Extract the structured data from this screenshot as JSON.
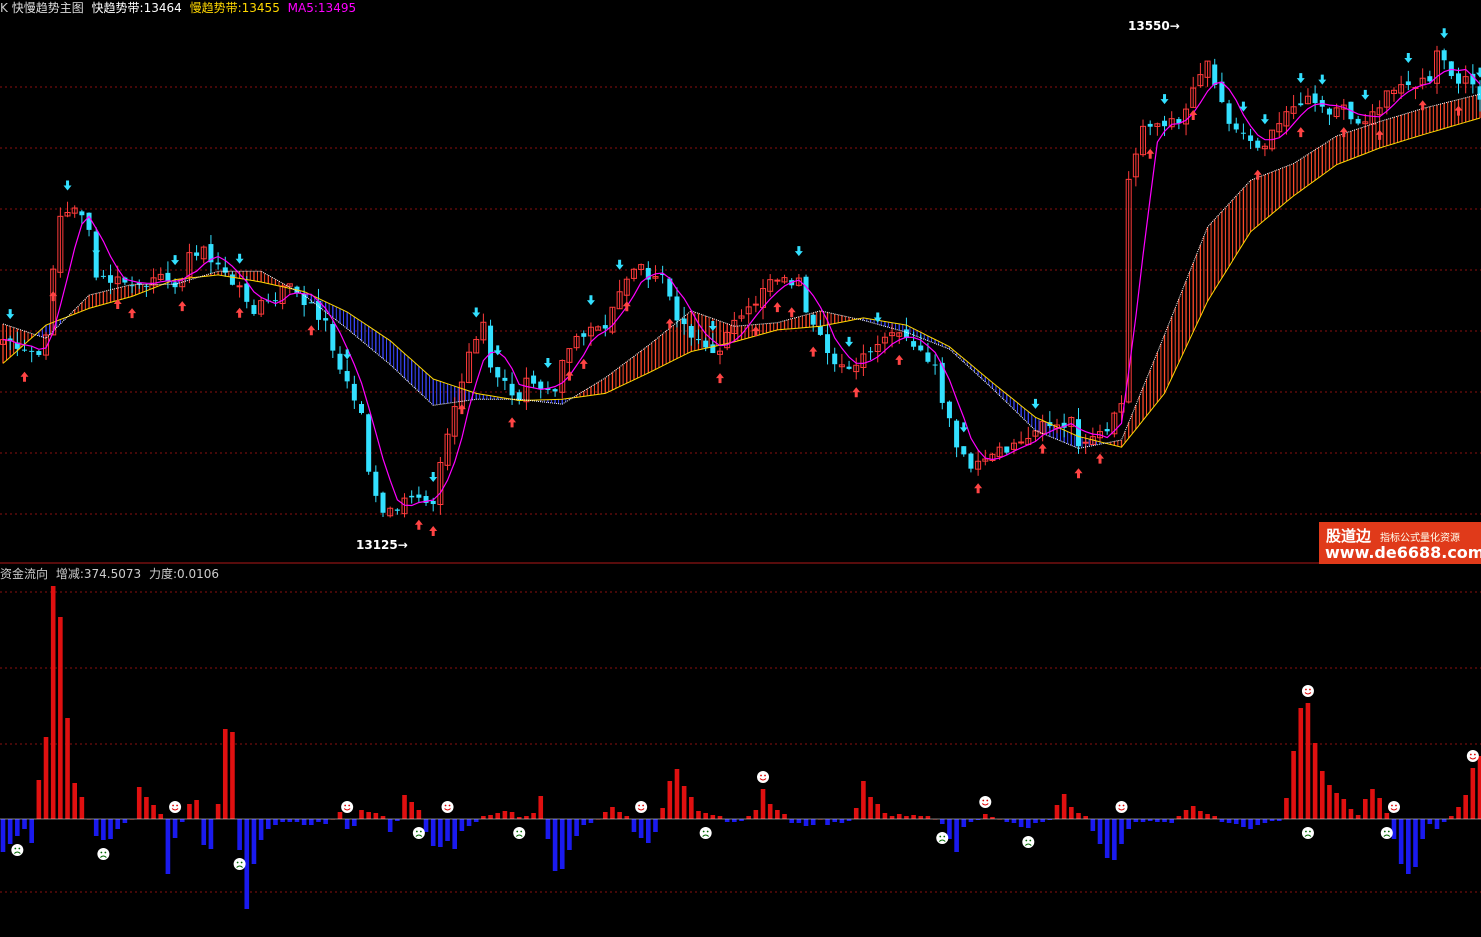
{
  "main_legend": {
    "mark": "K",
    "title": "快慢趋势主图",
    "fast_label": "快趋势带:",
    "fast_value": "13464",
    "slow_label": "慢趋势带:",
    "slow_value": "13455",
    "ma_label": "MA5:",
    "ma_value": "13495"
  },
  "sub_legend": {
    "title": "资金流向",
    "delta_label": "增减:",
    "delta_value": "374.5073",
    "force_label": "力度:",
    "force_value": "0.0106"
  },
  "extremes": {
    "high": "13550",
    "low": "13125"
  },
  "watermark": {
    "title": "股道边",
    "subtitle": "指标公式量化资源",
    "url": "www.de6688.com"
  },
  "colors": {
    "background": "#000000",
    "up": "#ff3b3b",
    "down": "#33e0ff",
    "fast_line": "#ffffff",
    "slow_line": "#ffd700",
    "ma5": "#ff00ff",
    "band_up": "#ff4a2a",
    "band_down": "#3a47ff",
    "flow_positive": "#e01010",
    "flow_negative": "#1a1aee",
    "grid": "#8a1010",
    "buy_signal": "#ff4444",
    "sell_signal": "#33e0ff"
  },
  "chart_data": [
    {
      "type": "candlestick",
      "title": "快慢趋势主图",
      "series_names": [
        "快趋势带",
        "慢趋势带",
        "MA5"
      ],
      "last_values": {
        "fast": 13464,
        "slow": 13455,
        "ma5": 13495
      },
      "high": 13550,
      "low": 13125,
      "price_path": [
        [
          0,
          13290
        ],
        [
          3,
          13284
        ],
        [
          5,
          13277
        ],
        [
          6,
          13298
        ],
        [
          8,
          13392
        ],
        [
          10,
          13402
        ],
        [
          12,
          13380
        ],
        [
          13,
          13346
        ],
        [
          15,
          13340
        ],
        [
          17,
          13341
        ],
        [
          18,
          13334
        ],
        [
          20,
          13338
        ],
        [
          21,
          13346
        ],
        [
          23,
          13334
        ],
        [
          25,
          13341
        ],
        [
          26,
          13358
        ],
        [
          28,
          13368
        ],
        [
          29,
          13354
        ],
        [
          31,
          13348
        ],
        [
          33,
          13330
        ],
        [
          35,
          13314
        ],
        [
          36,
          13322
        ],
        [
          38,
          13326
        ],
        [
          40,
          13338
        ],
        [
          41,
          13330
        ],
        [
          43,
          13316
        ],
        [
          45,
          13302
        ],
        [
          46,
          13281
        ],
        [
          48,
          13254
        ],
        [
          50,
          13226
        ],
        [
          51,
          13178
        ],
        [
          53,
          13148
        ],
        [
          55,
          13151
        ],
        [
          56,
          13162
        ],
        [
          58,
          13156
        ],
        [
          60,
          13148
        ],
        [
          61,
          13189
        ],
        [
          63,
          13234
        ],
        [
          65,
          13276
        ],
        [
          67,
          13305
        ],
        [
          68,
          13269
        ],
        [
          70,
          13253
        ],
        [
          72,
          13241
        ],
        [
          73,
          13255
        ],
        [
          75,
          13244
        ],
        [
          77,
          13243
        ],
        [
          78,
          13270
        ],
        [
          80,
          13292
        ],
        [
          82,
          13302
        ],
        [
          84,
          13302
        ],
        [
          85,
          13318
        ],
        [
          87,
          13338
        ],
        [
          88,
          13351
        ],
        [
          90,
          13345
        ],
        [
          92,
          13343
        ],
        [
          94,
          13310
        ],
        [
          95,
          13298
        ],
        [
          97,
          13286
        ],
        [
          99,
          13279
        ],
        [
          100,
          13284
        ],
        [
          102,
          13302
        ],
        [
          104,
          13322
        ],
        [
          105,
          13323
        ],
        [
          107,
          13338
        ],
        [
          109,
          13338
        ],
        [
          111,
          13338
        ],
        [
          112,
          13316
        ],
        [
          114,
          13298
        ],
        [
          116,
          13269
        ],
        [
          118,
          13262
        ],
        [
          119,
          13272
        ],
        [
          121,
          13284
        ],
        [
          123,
          13292
        ],
        [
          124,
          13300
        ],
        [
          126,
          13294
        ],
        [
          128,
          13278
        ],
        [
          130,
          13272
        ],
        [
          131,
          13242
        ],
        [
          133,
          13204
        ],
        [
          135,
          13186
        ],
        [
          137,
          13191
        ],
        [
          138,
          13199
        ],
        [
          140,
          13196
        ],
        [
          142,
          13206
        ],
        [
          143,
          13203
        ],
        [
          145,
          13220
        ],
        [
          147,
          13220
        ],
        [
          149,
          13221
        ],
        [
          150,
          13205
        ],
        [
          152,
          13212
        ],
        [
          154,
          13218
        ],
        [
          156,
          13237
        ],
        [
          157,
          13425
        ],
        [
          159,
          13464
        ],
        [
          161,
          13471
        ],
        [
          162,
          13472
        ],
        [
          164,
          13469
        ],
        [
          166,
          13496
        ],
        [
          168,
          13523
        ],
        [
          169,
          13498
        ],
        [
          171,
          13471
        ],
        [
          173,
          13460
        ],
        [
          175,
          13446
        ],
        [
          176,
          13451
        ],
        [
          178,
          13469
        ],
        [
          180,
          13485
        ],
        [
          181,
          13490
        ],
        [
          183,
          13487
        ],
        [
          185,
          13479
        ],
        [
          187,
          13483
        ],
        [
          188,
          13474
        ],
        [
          190,
          13468
        ],
        [
          192,
          13488
        ],
        [
          193,
          13499
        ],
        [
          195,
          13498
        ],
        [
          197,
          13504
        ],
        [
          199,
          13509
        ],
        [
          200,
          13534
        ],
        [
          202,
          13512
        ],
        [
          204,
          13505
        ],
        [
          205,
          13503
        ],
        [
          206,
          13495
        ]
      ],
      "fast_band_path": [
        [
          0,
          13303
        ],
        [
          6,
          13291
        ],
        [
          12,
          13327
        ],
        [
          18,
          13336
        ],
        [
          24,
          13336
        ],
        [
          30,
          13347
        ],
        [
          36,
          13347
        ],
        [
          42,
          13327
        ],
        [
          48,
          13299
        ],
        [
          54,
          13269
        ],
        [
          60,
          13235
        ],
        [
          66,
          13240
        ],
        [
          72,
          13240
        ],
        [
          78,
          13236
        ],
        [
          84,
          13258
        ],
        [
          90,
          13285
        ],
        [
          96,
          13314
        ],
        [
          102,
          13301
        ],
        [
          108,
          13304
        ],
        [
          114,
          13314
        ],
        [
          120,
          13306
        ],
        [
          126,
          13296
        ],
        [
          132,
          13282
        ],
        [
          138,
          13249
        ],
        [
          144,
          13214
        ],
        [
          150,
          13199
        ],
        [
          156,
          13206
        ],
        [
          162,
          13294
        ],
        [
          168,
          13384
        ],
        [
          174,
          13423
        ],
        [
          180,
          13437
        ],
        [
          186,
          13460
        ],
        [
          192,
          13472
        ],
        [
          198,
          13483
        ],
        [
          206,
          13495
        ]
      ],
      "slow_band_path": [
        [
          0,
          13270
        ],
        [
          6,
          13302
        ],
        [
          12,
          13316
        ],
        [
          18,
          13326
        ],
        [
          24,
          13340
        ],
        [
          30,
          13344
        ],
        [
          36,
          13338
        ],
        [
          42,
          13330
        ],
        [
          48,
          13313
        ],
        [
          54,
          13289
        ],
        [
          60,
          13257
        ],
        [
          66,
          13245
        ],
        [
          72,
          13239
        ],
        [
          78,
          13240
        ],
        [
          84,
          13245
        ],
        [
          90,
          13262
        ],
        [
          96,
          13280
        ],
        [
          102,
          13288
        ],
        [
          108,
          13298
        ],
        [
          114,
          13301
        ],
        [
          120,
          13308
        ],
        [
          126,
          13302
        ],
        [
          132,
          13284
        ],
        [
          138,
          13254
        ],
        [
          144,
          13225
        ],
        [
          150,
          13209
        ],
        [
          156,
          13200
        ],
        [
          162,
          13245
        ],
        [
          168,
          13322
        ],
        [
          174,
          13380
        ],
        [
          180,
          13410
        ],
        [
          186,
          13436
        ],
        [
          192,
          13450
        ],
        [
          198,
          13461
        ],
        [
          206,
          13475
        ]
      ],
      "buy_signals": [
        3,
        7,
        16,
        18,
        25,
        33,
        43,
        58,
        60,
        64,
        71,
        79,
        81,
        87,
        93,
        100,
        105,
        108,
        110,
        113,
        119,
        125,
        136,
        145,
        150,
        153,
        160,
        166,
        175,
        181,
        187,
        192,
        198,
        203
      ],
      "sell_signals": [
        1,
        9,
        13,
        24,
        33,
        48,
        60,
        66,
        69,
        76,
        82,
        86,
        99,
        111,
        118,
        122,
        134,
        144,
        162,
        173,
        176,
        181,
        184,
        190,
        196,
        201,
        206
      ]
    },
    {
      "type": "bar",
      "title": "资金流向",
      "series_names": [
        "增减",
        "力度"
      ],
      "last_values": {
        "delta": 374.5073,
        "force": 0.0106
      },
      "values": [
        -33,
        -25,
        -17,
        -10,
        -24,
        39,
        82,
        233,
        202,
        101,
        36,
        22,
        0,
        -17,
        -21,
        -20,
        -10,
        -4,
        0,
        32,
        22,
        14,
        5,
        -55,
        -19,
        -3,
        15,
        19,
        -26,
        -30,
        15,
        90,
        87,
        -31,
        -90,
        -45,
        -21,
        -10,
        -6,
        -3,
        -3,
        -3,
        -6,
        -6,
        -3,
        -5,
        0,
        7,
        -10,
        -7,
        9,
        7,
        6,
        3,
        -13,
        -2,
        24,
        17,
        9,
        -13,
        -27,
        -28,
        -22,
        -30,
        -12,
        -7,
        -3,
        3,
        4,
        6,
        8,
        7,
        2,
        3,
        6,
        23,
        -20,
        -52,
        -50,
        -31,
        -17,
        -6,
        -4,
        0,
        7,
        12,
        7,
        3,
        -13,
        -19,
        -24,
        -13,
        11,
        38,
        50,
        33,
        22,
        8,
        6,
        4,
        3,
        -3,
        -3,
        -2,
        3,
        9,
        30,
        15,
        9,
        5,
        -4,
        -4,
        -7,
        -6,
        0,
        -6,
        -3,
        -4,
        -2,
        11,
        38,
        22,
        15,
        6,
        3,
        5,
        3,
        4,
        3,
        3,
        0,
        -5,
        -20,
        -33,
        -8,
        -3,
        -1,
        5,
        2,
        0,
        -3,
        -4,
        -8,
        -9,
        -4,
        -3,
        -1,
        14,
        25,
        12,
        6,
        3,
        -12,
        -25,
        -39,
        -41,
        -25,
        -10,
        -3,
        -3,
        -2,
        -3,
        -3,
        -4,
        3,
        9,
        13,
        8,
        5,
        3,
        -3,
        -4,
        -5,
        -8,
        -10,
        -6,
        -4,
        -2,
        -2,
        21,
        68,
        111,
        116,
        76,
        48,
        34,
        26,
        20,
        10,
        4,
        20,
        30,
        21,
        6,
        -20,
        -45,
        -55,
        -48,
        -20,
        -5,
        -10,
        -3,
        3,
        12,
        24,
        51,
        63,
        37,
        18,
        11,
        4,
        3,
        0,
        -5,
        1,
        -4,
        -7,
        -9,
        -14,
        -24,
        -46,
        -64,
        -70,
        -92,
        -129,
        -100,
        -45,
        -24,
        -5,
        -3,
        -1,
        3,
        -3,
        -3,
        15,
        19,
        -10,
        -33,
        -28,
        -35,
        -20,
        -10,
        8,
        19,
        -3,
        -4,
        -5,
        4
      ],
      "good_markers": [
        24,
        48,
        62,
        89,
        106,
        137,
        156,
        182,
        194,
        205
      ],
      "bad_markers": [
        2,
        14,
        33,
        58,
        72,
        98,
        131,
        143,
        182,
        193,
        211
      ]
    }
  ]
}
